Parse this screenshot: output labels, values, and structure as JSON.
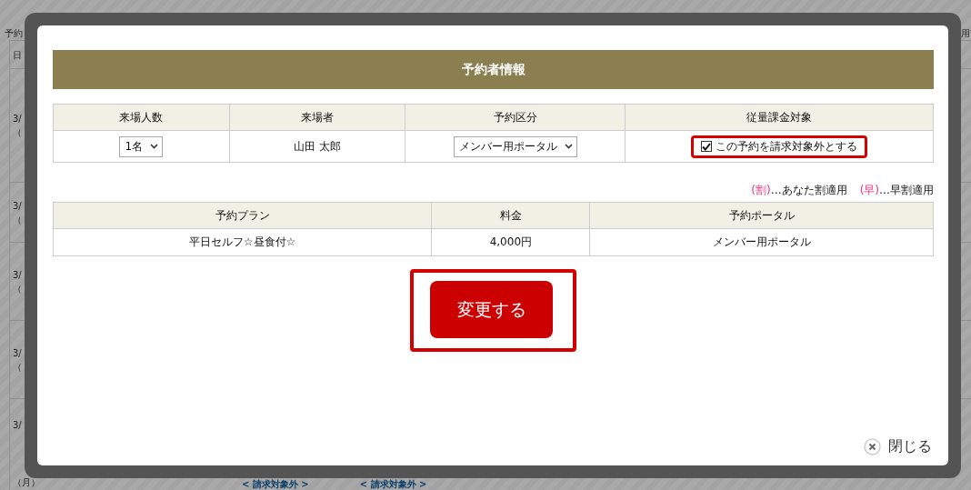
{
  "background_page": {
    "heading": "予約",
    "heading_right": "用",
    "table_header": "日",
    "date_rows": [
      {
        "date": "3/",
        "weekday": "（"
      },
      {
        "date": "3/",
        "weekday": "（"
      },
      {
        "date": "3/",
        "weekday": "（"
      },
      {
        "date": "3/",
        "weekday": "（"
      },
      {
        "date": "3/",
        "weekday": "（月）"
      }
    ],
    "bottom_links": [
      "< 請求対象外 >",
      "< 請求対象外 >"
    ]
  },
  "dialog": {
    "title": "予約者情報",
    "visitor_table": {
      "columns": [
        "来場人数",
        "来場者",
        "予約区分",
        "従量課金対象"
      ],
      "row": {
        "count": "1名",
        "visitor": "山田 太郎",
        "category": "メンバー用ポータル",
        "exclude_billing": {
          "label": "この予約を請求対象外とする",
          "checked": true
        }
      }
    },
    "legend": [
      {
        "mark": "(割)",
        "text": "…あなた割適用"
      },
      {
        "mark": "(早)",
        "text": "…早割適用"
      }
    ],
    "plan_table": {
      "columns": [
        "予約プラン",
        "料金",
        "予約ポータル"
      ],
      "rows": [
        [
          "平日セルフ☆昼食付☆",
          "4,000円",
          "メンバー用ポータル"
        ]
      ]
    },
    "submit_button": "変更する",
    "close_button": "閉じる"
  }
}
